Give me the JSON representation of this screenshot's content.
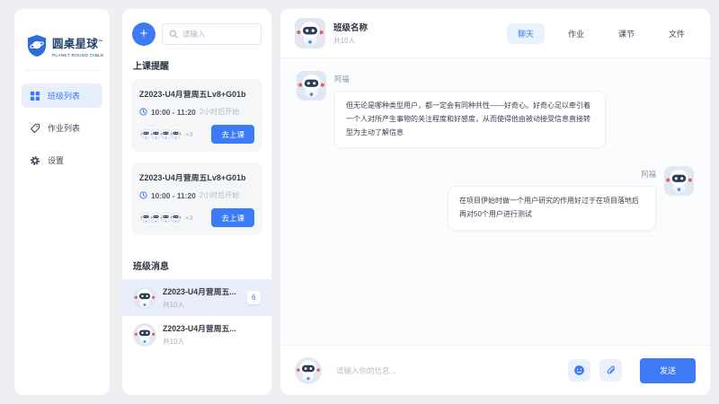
{
  "colors": {
    "accent": "#3d7bf5"
  },
  "sidebar": {
    "logo_title": "圆桌星球",
    "logo_tm": "™",
    "logo_subtitle": "PLANET ROUND TABLE",
    "items": [
      {
        "label": "班级列表"
      },
      {
        "label": "作业列表"
      },
      {
        "label": "设置"
      }
    ]
  },
  "panel": {
    "add_label": "+",
    "search_placeholder": "请输入",
    "reminder_title": "上课提醒",
    "classes": [
      {
        "title": "Z2023-U4月营周五Lv8+G01b",
        "time": "10:00 - 11:20",
        "hint": "2小时后开始",
        "extra": "+3",
        "action": "去上课"
      },
      {
        "title": "Z2023-U4月营周五Lv8+G01b",
        "time": "10:00 - 11:20",
        "hint": "2小时后开始",
        "extra": "+3",
        "action": "去上课"
      }
    ],
    "messages_title": "班级消息",
    "rows": [
      {
        "title": "Z2023-U4月营周五...",
        "members": "共10人",
        "badge": "6"
      },
      {
        "title": "Z2023-U4月营周五...",
        "members": "共10人"
      }
    ]
  },
  "chat": {
    "title": "班级名称",
    "members": "共10人",
    "tabs": [
      {
        "label": "聊天"
      },
      {
        "label": "作业"
      },
      {
        "label": "课节"
      },
      {
        "label": "文件"
      }
    ],
    "messages": [
      {
        "name": "阿福",
        "text": "但无论是哪种类型用户，都一定会有同种共性——好奇心。好奇心足以牵引着一个人对所产生事物的关注程度和好感度，从而使得他由被动接受信息直接转型为主动了解信息"
      },
      {
        "name": "阿福",
        "text": "在项目伊始时做一个用户研究的作用好过于在项目落地后再对50个用户进行测试"
      }
    ],
    "input_placeholder": "请输入你的信息...",
    "send_label": "发送"
  }
}
